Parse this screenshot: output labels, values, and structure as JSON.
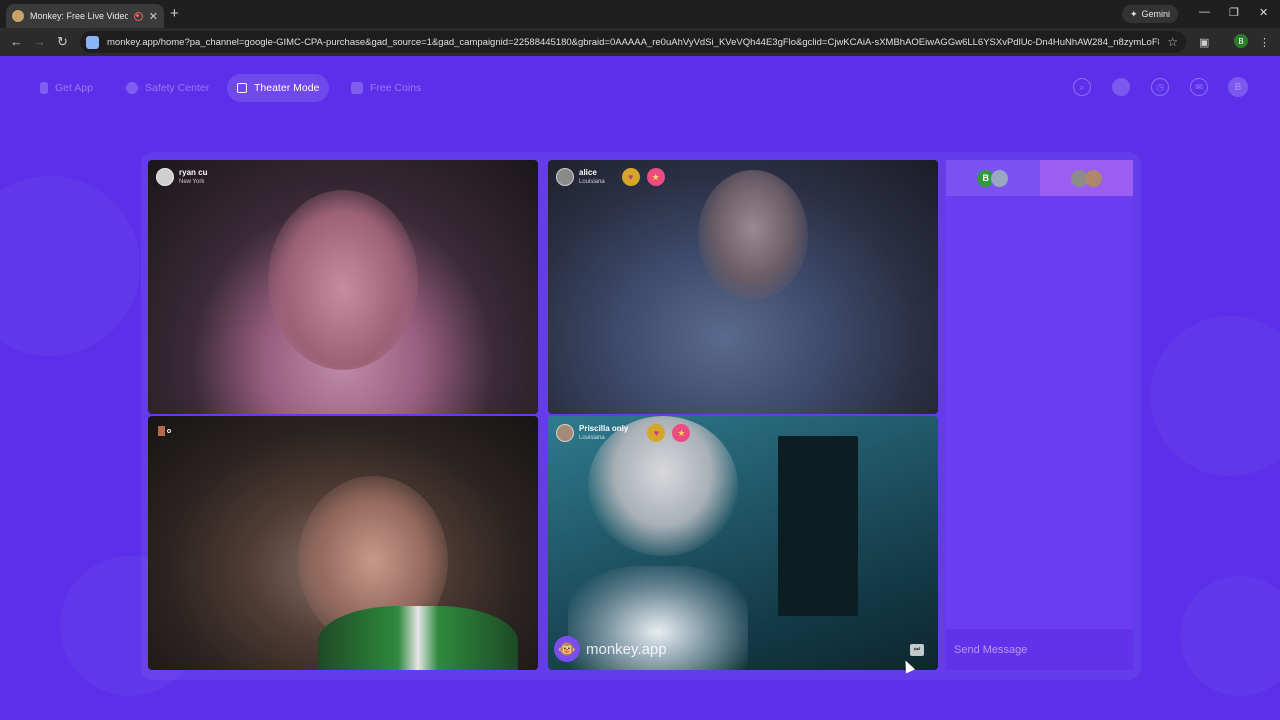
{
  "browser": {
    "tab_title": "Monkey: Free Live Video Ch",
    "tab_close": "✕",
    "new_tab": "+",
    "gemini_label": "Gemini",
    "url": "monkey.app/home?pa_channel=google-GIMC-CPA-purchase&gad_source=1&gad_campaignid=22588445180&gbraid=0AAAAA_re0uAhVyVdSi_KVeVQh44E3gFlo&gclid=CjwKCAiA-sXMBhAOEiwAGGw6LL6YSXvPdlUc-Dn4HuNhAW284_n8zymLoF8IIWfcACl...",
    "profile_initial": "B"
  },
  "nav": {
    "get_app": "Get App",
    "safety_center": "Safety Center",
    "theater_mode": "Theater Mode",
    "free_coins": "Free Coins",
    "account_initial": "B"
  },
  "tiles": [
    {
      "name": "ryan cu",
      "location": "New York"
    },
    {
      "name": "alice",
      "location": "Louisiana"
    },
    {
      "name": "",
      "location": ""
    },
    {
      "name": "Priscilla only",
      "location": "Louisiana"
    }
  ],
  "watermark": "monkey.app",
  "chat": {
    "tab_a_initial": "B",
    "placeholder": "Send Message"
  },
  "colors": {
    "background": "#5c30ea",
    "accent": "#7b4df0"
  }
}
